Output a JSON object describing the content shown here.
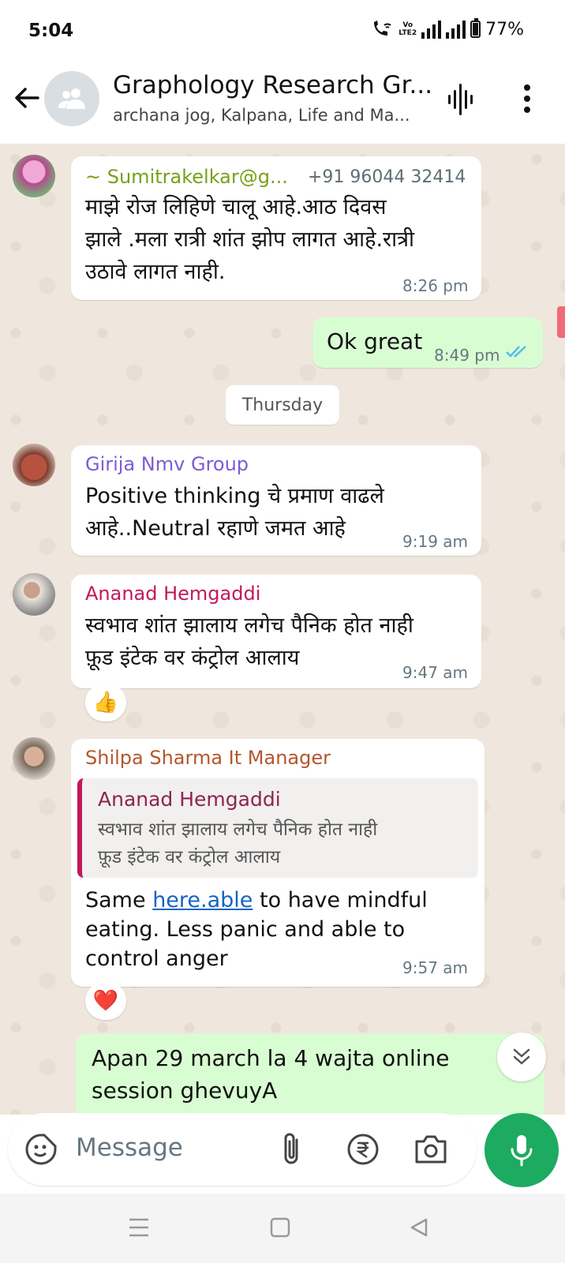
{
  "status_bar": {
    "time": "5:04",
    "battery": "77%",
    "network": "Vo LTE2"
  },
  "header": {
    "title": "Graphology Research Gr...",
    "subtitle": "archana jog, Kalpana, Life and Ma..."
  },
  "messages": [
    {
      "sender": "~ Sumitrakelkar@g...",
      "phone": "+91 96044 32414",
      "lines": [
        "माझे रोज लिहिणे चालू आहे.आठ दिवस",
        "झाले .मला रात्री शांत झोप लागत आहे.रात्री",
        "उठावे लागत नाही."
      ],
      "time": "8:26 pm",
      "sender_color": "#7aa018"
    },
    {
      "outgoing": true,
      "text": "Ok great",
      "time": "8:49 pm",
      "status": "read"
    },
    {
      "sender": "Girija Nmv Group",
      "lines": [
        "Positive thinking चे प्रमाण वाढले",
        "आहे..Neutral रहाणे जमत आहे"
      ],
      "time": "9:19 am",
      "sender_color": "#7c5cd6"
    },
    {
      "sender": "Ananad Hemgaddi",
      "lines": [
        "स्वभाव शांत झालाय लगेच पैनिक होत नाही",
        "फ़ूड इंटेक वर कंट्रोल आलाय"
      ],
      "time": "9:47 am",
      "reaction": "👍",
      "sender_color": "#c2185b"
    },
    {
      "sender": "Shilpa Sharma It Manager",
      "quote": {
        "name": "Ananad Hemgaddi",
        "lines": [
          "स्वभाव शांत झालाय लगेच पैनिक होत नाही",
          "फ़ूड इंटेक वर कंट्रोल आलाय"
        ]
      },
      "text_before_link": "Same ",
      "link": "here.able",
      "text_after_link": " to have mindful",
      "lines_after": [
        "eating. Less panic and able to",
        "control anger"
      ],
      "time": "9:57 am",
      "reaction": "❤️",
      "sender_color": "#b4562c"
    },
    {
      "outgoing": true,
      "lines": [
        "Apan 29 march la 4 wajta online",
        "session ghevuyA"
      ]
    }
  ],
  "day_divider": "Thursday",
  "input": {
    "placeholder": "Message"
  },
  "colors": {
    "outgoing_bubble": "#d9fdd3",
    "mic_button": "#1daa61",
    "chat_bg": "#efe7dd"
  }
}
